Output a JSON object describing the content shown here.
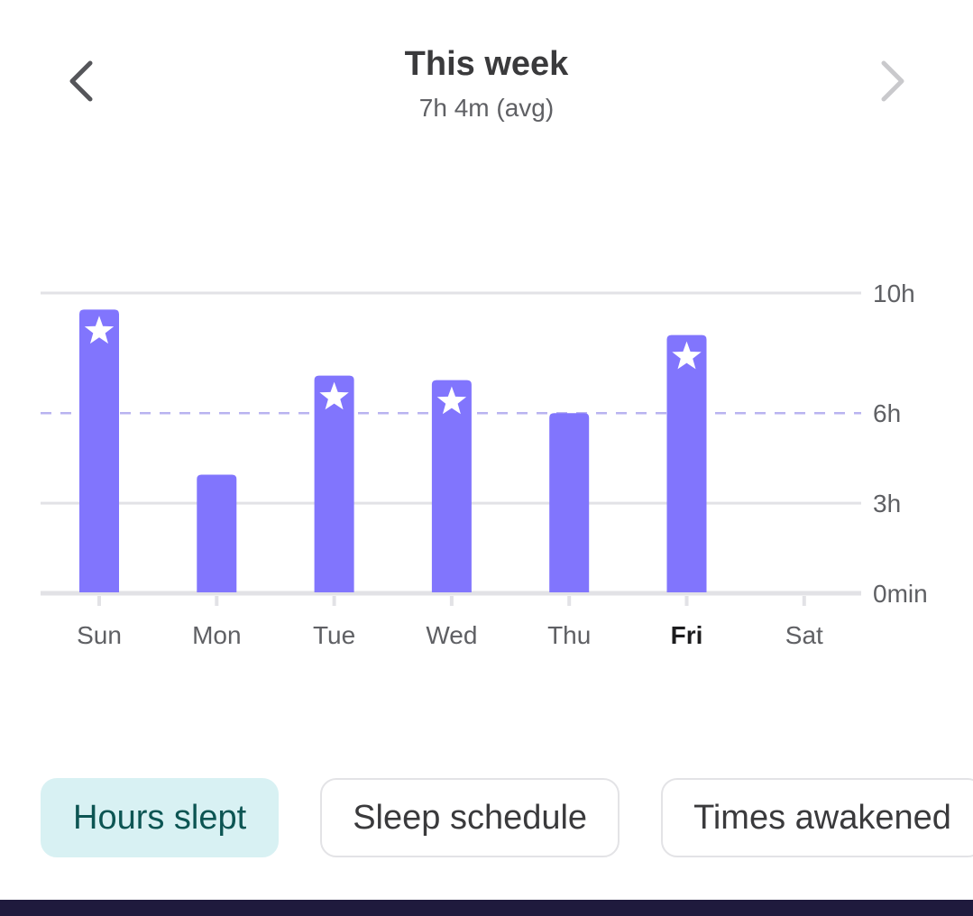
{
  "header": {
    "title": "This week",
    "subtitle": "7h 4m (avg)",
    "prev_icon": "chevron-left-icon",
    "next_icon": "chevron-right-icon"
  },
  "colors": {
    "bar": "#8175fd",
    "goal_line": "#b9b3f0",
    "goal_label": "#7b6fd6",
    "grid": "#e2e2e6",
    "chip_active_bg": "#d8f1f3",
    "chip_active_text": "#0c5553"
  },
  "chart_data": {
    "type": "bar",
    "title": "This week",
    "xlabel": "",
    "ylabel": "Hours slept",
    "categories": [
      "Sun",
      "Mon",
      "Tue",
      "Wed",
      "Thu",
      "Fri",
      "Sat"
    ],
    "values": [
      9.45,
      3.95,
      7.25,
      7.1,
      6.0,
      8.6,
      null
    ],
    "goal_met": [
      true,
      false,
      true,
      true,
      false,
      true,
      false
    ],
    "highlighted_category": "Fri",
    "goal": {
      "value": 6,
      "label": "6h",
      "style": "dashed"
    },
    "yticks": [
      {
        "value": 0,
        "label": "0min"
      },
      {
        "value": 3,
        "label": "3h"
      },
      {
        "value": 6,
        "label": "6h"
      },
      {
        "value": 10,
        "label": "10h"
      }
    ],
    "ylim": [
      0,
      10
    ],
    "grid": true,
    "y_axis_side": "right",
    "marker_icon": "star-icon"
  },
  "chips": [
    {
      "label": "Hours slept",
      "active": true
    },
    {
      "label": "Sleep schedule",
      "active": false
    },
    {
      "label": "Times awakened",
      "active": false
    }
  ]
}
